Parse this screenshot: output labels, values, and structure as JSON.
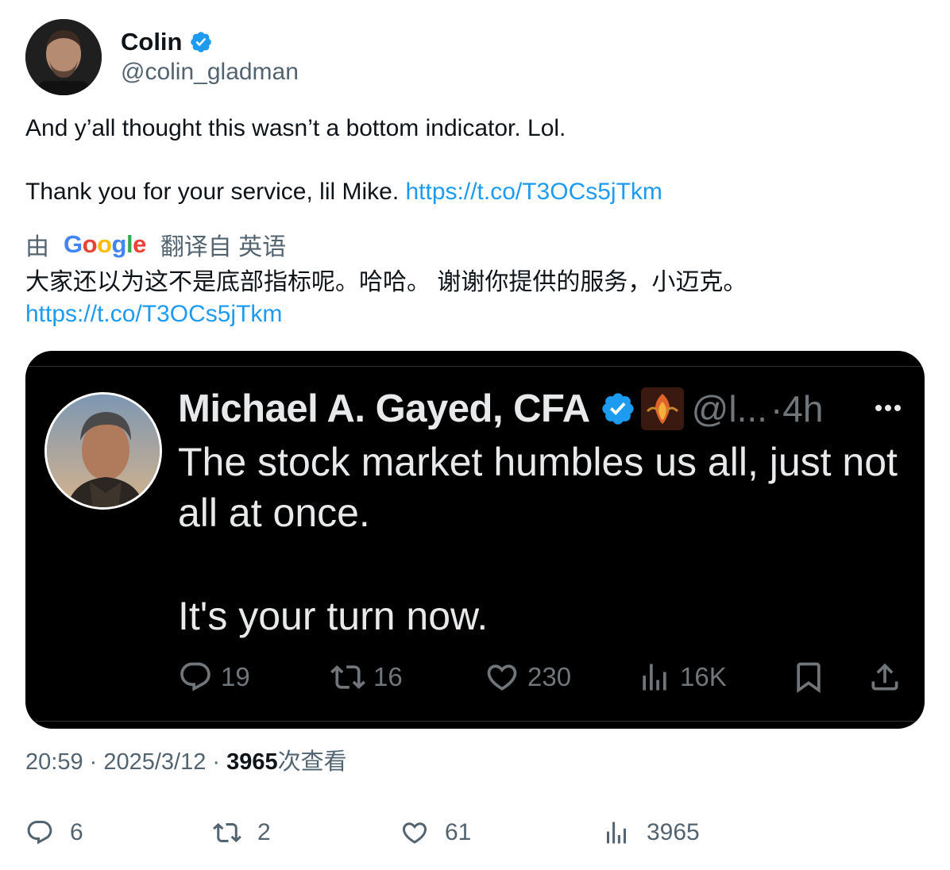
{
  "author": {
    "display_name": "Colin",
    "handle": "@colin_gladman"
  },
  "tweet": {
    "line1": "And y’all thought this wasn’t a bottom indicator. Lol.",
    "line2": "Thank you for your service, lil Mike. ",
    "link": "https://t.co/T3OCs5jTkm"
  },
  "translation": {
    "prefix": "由",
    "provider": "Google",
    "suffix": "翻译自 英语",
    "text": "大家还以为这不是底部指标呢。哈哈。 谢谢你提供的服务，小迈克。",
    "link": "https://t.co/T3OCs5jTkm"
  },
  "embedded_tweet": {
    "display_name": "Michael A. Gayed, CFA",
    "handle": "@l...",
    "time": "·4h",
    "line1": "The stock market humbles us all, just not all at once.",
    "line2": "It's your turn now.",
    "replies": "19",
    "reposts": "16",
    "likes": "230",
    "views": "16K"
  },
  "meta": {
    "time": "20:59",
    "date": "2025/3/12",
    "views_count": "3965",
    "views_label": "次查看",
    "separator": " · "
  },
  "actions": {
    "replies": "6",
    "reposts": "2",
    "likes": "61",
    "views": "3965"
  },
  "colors": {
    "link": "#1d9bf0",
    "secondary": "#536471",
    "verified": "#1d9bf0"
  }
}
